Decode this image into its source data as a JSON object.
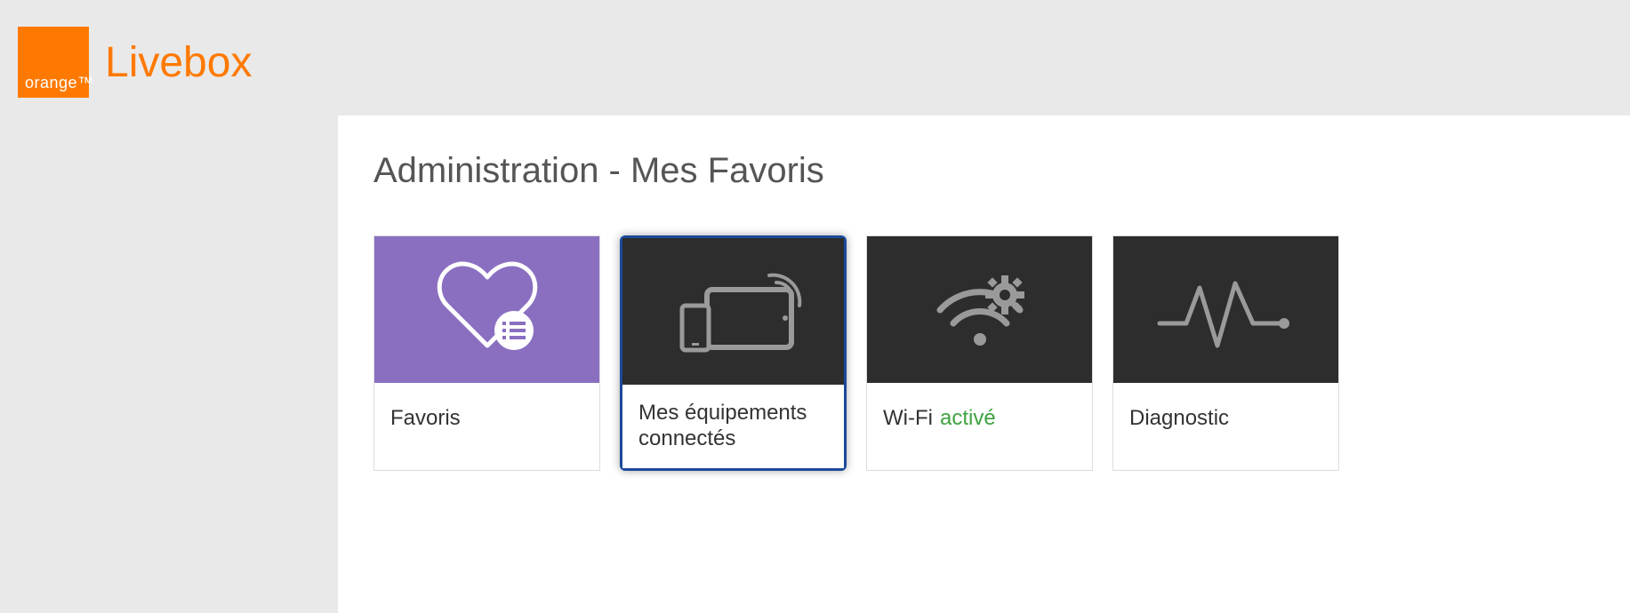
{
  "brand": {
    "logo_text": "orange",
    "product_name": "Livebox"
  },
  "page": {
    "title": "Administration - Mes Favoris"
  },
  "tiles": {
    "favoris": {
      "label": "Favoris"
    },
    "equipements": {
      "label": "Mes équipements connectés"
    },
    "wifi": {
      "label_prefix": "Wi-Fi",
      "status": "activé"
    },
    "diagnostic": {
      "label": "Diagnostic"
    }
  },
  "colors": {
    "accent": "#ff7900",
    "tile_purple": "#8a6fc1",
    "tile_dark": "#2d2d2d",
    "status_active": "#3fa23f",
    "selected_border": "#1a4a9a"
  }
}
